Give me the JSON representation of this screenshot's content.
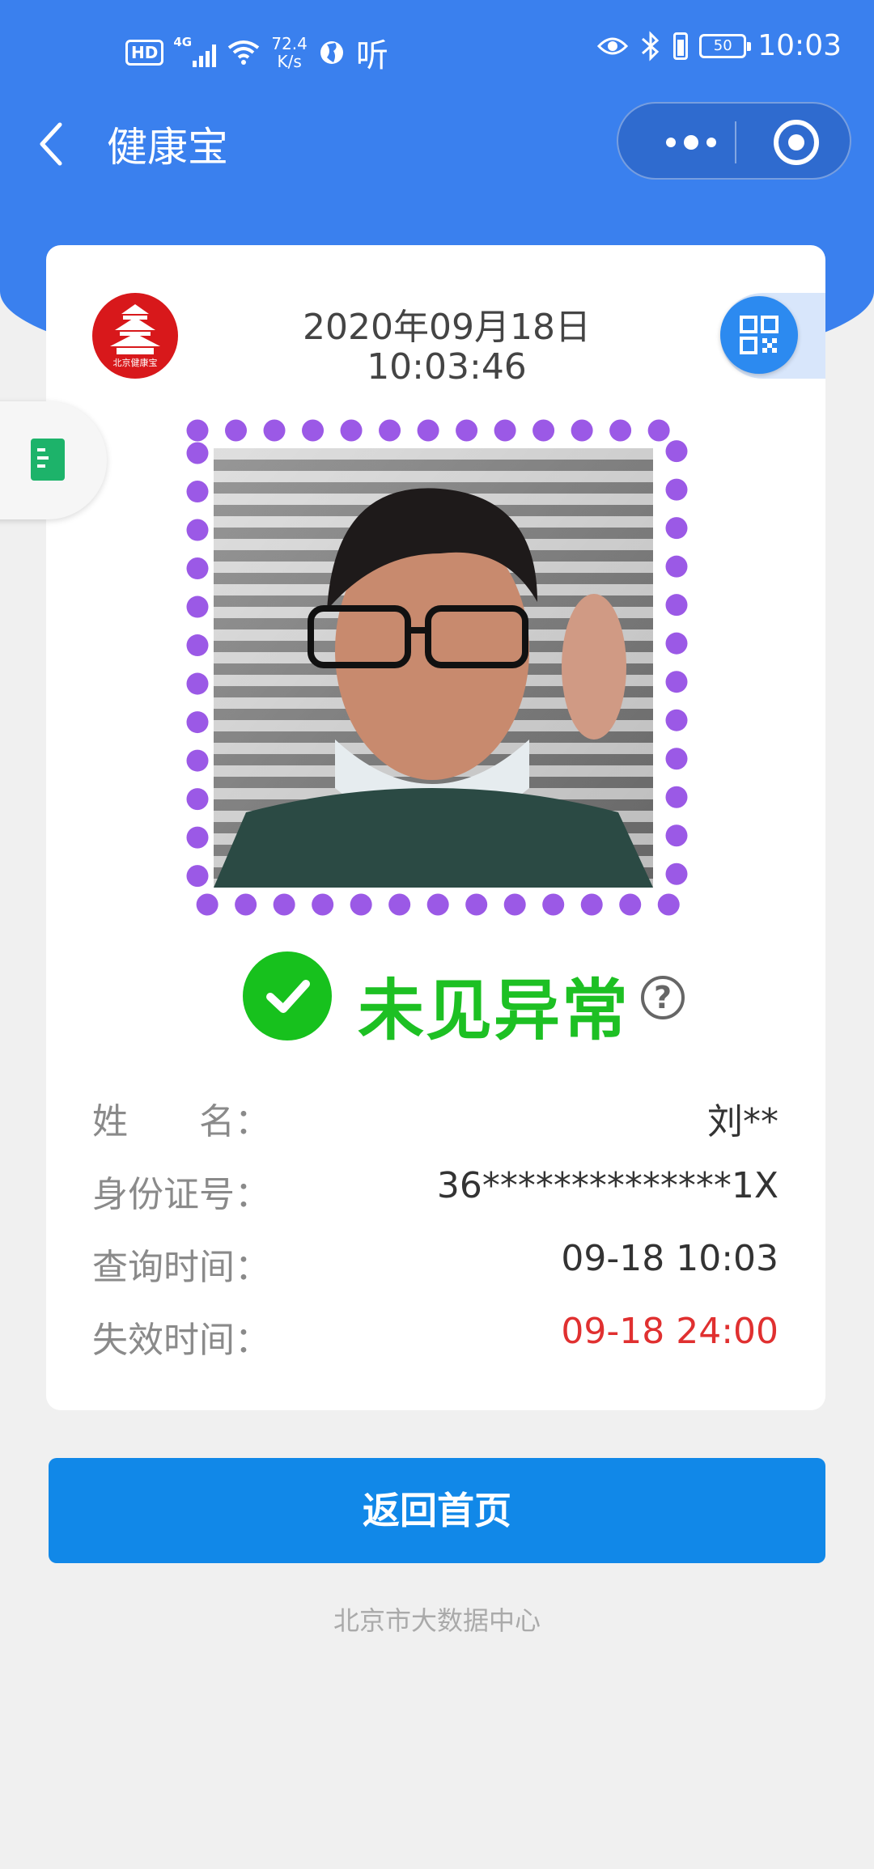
{
  "status_bar": {
    "hd": "HD",
    "network": "4G",
    "speed_value": "72.4",
    "speed_unit": "K/s",
    "listen": "听",
    "battery": "50",
    "time": "10:03"
  },
  "nav": {
    "title": "健康宝"
  },
  "card": {
    "logo_text": "北京健康宝",
    "date": "2020年09月18日",
    "time": "10:03:46",
    "status": "未见异常",
    "status_color": "#1dc023",
    "help_symbol": "?",
    "frame_color": "#9b59e6",
    "info": [
      {
        "label": "姓　　名：",
        "value": "刘**"
      },
      {
        "label": "身份证号：",
        "value": "36**************1X"
      },
      {
        "label": "查询时间：",
        "value": "09-18 10:03"
      },
      {
        "label": "失效时间：",
        "value": "09-18 24:00",
        "value_color": "#e03030"
      }
    ]
  },
  "home_button": "返回首页",
  "footer": "北京市大数据中心",
  "colors": {
    "header_blue": "#3a80ee",
    "button_blue": "#1188e8",
    "logo_red": "#d8181b"
  }
}
